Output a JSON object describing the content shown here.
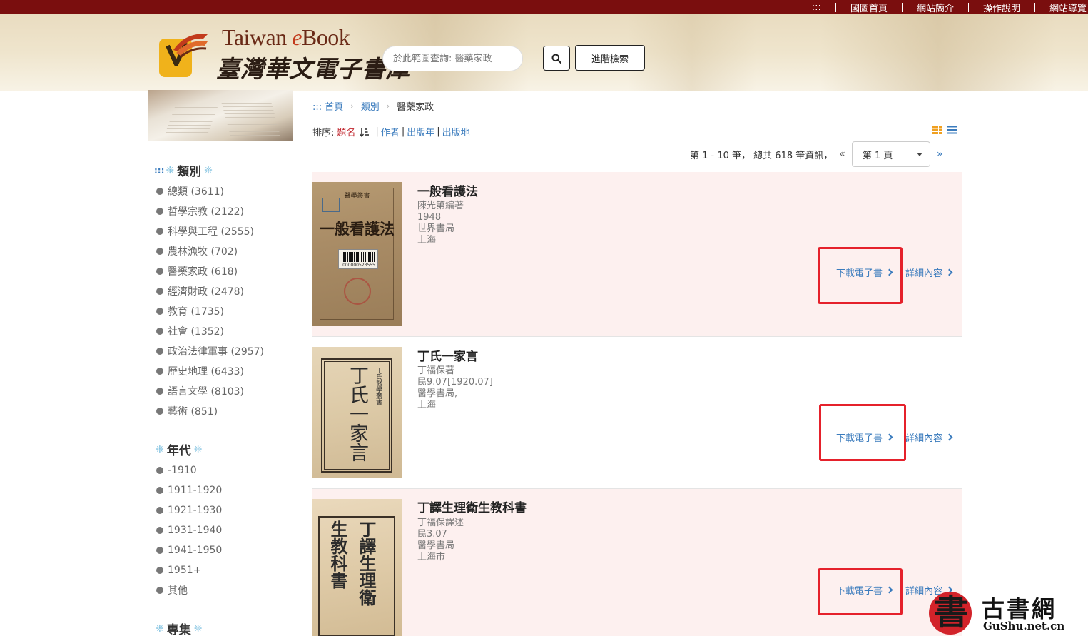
{
  "top_nav": {
    "prefix": ":::",
    "links": [
      "國圖首頁",
      "網站簡介",
      "操作說明",
      "網站導覽"
    ]
  },
  "logo": {
    "en_part1": "Taiwan ",
    "en_part2": "e",
    "en_part3": "Book",
    "zh": "臺灣華文電子書庫"
  },
  "search": {
    "placeholder": "於此範圍查詢: 醫藥家政",
    "advanced_label": "進階檢索"
  },
  "breadcrumb": {
    "home": "::: 首頁",
    "category": "類別",
    "current": "醫藥家政"
  },
  "sort": {
    "label": "排序:",
    "options": [
      "題名",
      "作者",
      "出版年",
      "出版地"
    ],
    "active": "題名"
  },
  "pager": {
    "summary": "第 1 - 10 筆， 總共 618 筆資訊，",
    "prev": "«",
    "next": "»",
    "page_selected": "第 1 頁"
  },
  "sidebar": {
    "category_heading": "類別",
    "category_prefix": ":::",
    "categories": [
      "總類 (3611)",
      "哲學宗教 (2122)",
      "科學與工程 (2555)",
      "農林漁牧 (702)",
      "醫藥家政 (618)",
      "經濟財政 (2478)",
      "教育 (1735)",
      "社會 (1352)",
      "政治法律軍事 (2957)",
      "歷史地理 (6433)",
      "語言文學 (8103)",
      "藝術 (851)"
    ],
    "era_heading": "年代",
    "eras": [
      "-1910",
      "1911-1920",
      "1921-1930",
      "1931-1940",
      "1941-1950",
      "1951+",
      "其他"
    ],
    "topic_heading": "專集"
  },
  "books": [
    {
      "title": "一般看護法",
      "author": "陳光第編著",
      "year": "1948",
      "publisher": "世界書局",
      "place": "上海",
      "cover_text": "一般看護法",
      "cover_series": "醫學叢書",
      "cover_barcode": "000000523555",
      "download_label": "下載電子書",
      "detail_label": "詳細內容"
    },
    {
      "title": "丁氏一家言",
      "author": "丁福保著",
      "year": "民9.07[1920.07]",
      "publisher": "醫學書局,",
      "place": "上海",
      "cover_text": "丁氏一家言",
      "cover_series": "丁氏醫學叢書",
      "download_label": "下載電子書",
      "detail_label": "詳細內容"
    },
    {
      "title": "丁譯生理衛生教科書",
      "author": "丁福保譯述",
      "year": "民3.07",
      "publisher": "醫學書局",
      "place": "上海市",
      "cover_text_right": "丁譯生理衛",
      "cover_text_left": "生教科書",
      "download_label": "下載電子書",
      "detail_label": "詳細內容"
    }
  ],
  "watermark": {
    "seal_char": "書",
    "name": "古書網",
    "url": "GuShu.net.cn"
  },
  "colors": {
    "topbar": "#7a0e0e",
    "link": "#3a7bbd",
    "active_sort": "#c0242c",
    "card_highlight": "#fdf0ef",
    "annotation_box": "#e5212b",
    "ornament": "#7fc1e0",
    "grid_icon": "#f0a020"
  }
}
